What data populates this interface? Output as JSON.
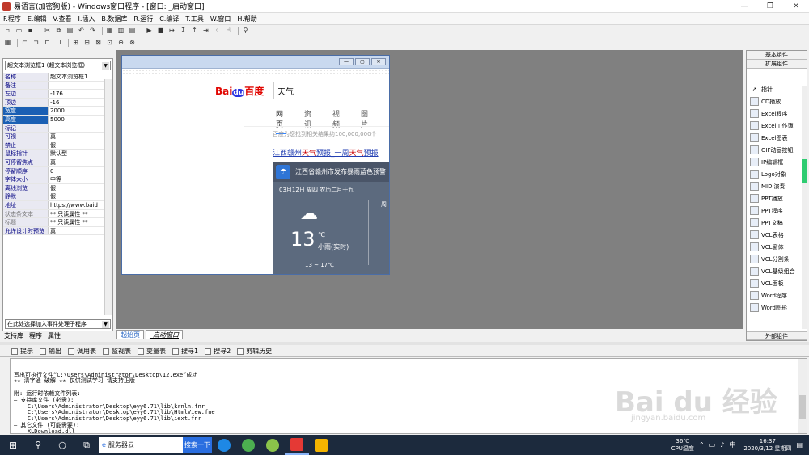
{
  "window": {
    "title": "易语言(加密狗版) - Windows窗口程序 - [窗口: _启动窗口]",
    "controls": [
      "—",
      "❐",
      "✕"
    ]
  },
  "menu": [
    "F.程序",
    "E.编辑",
    "V.查看",
    "I.插入",
    "B.数据库",
    "R.运行",
    "C.编译",
    "T.工具",
    "W.窗口",
    "H.帮助"
  ],
  "left_panel": {
    "object_select": "超文本浏览框1 (超文本浏览框)",
    "properties": [
      {
        "name": "名称",
        "value": "超文本浏览框1"
      },
      {
        "name": "备注",
        "value": ""
      },
      {
        "name": "左边",
        "value": "-176"
      },
      {
        "name": "顶边",
        "value": "-16"
      },
      {
        "name": "宽度",
        "value": "2000"
      },
      {
        "name": "高度",
        "value": "5000"
      },
      {
        "name": "标记",
        "value": ""
      },
      {
        "name": "可视",
        "value": "真"
      },
      {
        "name": "禁止",
        "value": "假"
      },
      {
        "name": "鼠标指针",
        "value": "默认型"
      },
      {
        "name": "可停留焦点",
        "value": "真"
      },
      {
        "name": "停留顺序",
        "value": "0"
      },
      {
        "name": "字体大小",
        "value": "中等"
      },
      {
        "name": "离线浏览",
        "value": "假"
      },
      {
        "name": "静默",
        "value": "假"
      },
      {
        "name": "地址",
        "value": "https://www.baid"
      },
      {
        "name": "状态条文本",
        "value": "** 只读属性 **"
      },
      {
        "name": "标题",
        "value": "** 只读属性 **"
      },
      {
        "name": "允许设计时预览",
        "value": "真"
      }
    ],
    "event_select": "在此处选择加入事件处理子程序",
    "tabs": [
      "支持库",
      "程序",
      "属性"
    ]
  },
  "browser": {
    "logo_a": "Bai",
    "logo_b": "du",
    "logo_c": "百度",
    "query": "天气",
    "tabs": [
      "网页",
      "资讯",
      "视频",
      "图片"
    ],
    "count": "百度为您找到相关结果约100,000,000个",
    "link_a": "江西赣州",
    "link_b": "天气",
    "link_c": "预报_一周",
    "link_d": "天气",
    "link_e": "预报",
    "weather_title": "江西省赣州市发布暴雨蓝色预警",
    "weather_date": "03月12日 周四 农历二月十九",
    "temp": "13",
    "unit": "℃",
    "desc": "小雨(实时)",
    "range": "13 ~ 17℃",
    "next_day": "周"
  },
  "right_panel": {
    "basic_label": "基本组件",
    "ext_label": "扩展组件",
    "external_label": "外部组件",
    "items": [
      {
        "label": "指针",
        "icon": "pointer-icon"
      },
      {
        "label": "CD播放",
        "icon": "cd-icon"
      },
      {
        "label": "Excel程序",
        "icon": "excel-icon"
      },
      {
        "label": "Excel工作簿",
        "icon": "excel-icon"
      },
      {
        "label": "Excel图表",
        "icon": "excel-icon"
      },
      {
        "label": "GIF动画按钮",
        "icon": "gif-icon"
      },
      {
        "label": "IP编辑框",
        "icon": "ip-icon"
      },
      {
        "label": "Logo对象",
        "icon": "logo-icon"
      },
      {
        "label": "MIDI演奏",
        "icon": "midi-icon"
      },
      {
        "label": "PPT播放",
        "icon": "ppt-icon"
      },
      {
        "label": "PPT程序",
        "icon": "ppt-icon"
      },
      {
        "label": "PPT文稿",
        "icon": "ppt-icon"
      },
      {
        "label": "VCL表格",
        "icon": "vcl-icon"
      },
      {
        "label": "VCL窗体",
        "icon": "vcl-icon"
      },
      {
        "label": "VCL分割条",
        "icon": "vcl-icon"
      },
      {
        "label": "VCL基级组合",
        "icon": "vcl-icon"
      },
      {
        "label": "VCL面板",
        "icon": "vcl-icon"
      },
      {
        "label": "Word程序",
        "icon": "word-icon"
      },
      {
        "label": "Word图形",
        "icon": "word-icon"
      }
    ]
  },
  "doc_tabs": [
    "起始页",
    "_启动窗口"
  ],
  "bottom_tabs": [
    "提示",
    "输出",
    "调用表",
    "监视表",
    "变量表",
    "搜寻1",
    "搜寻2",
    "剪辑历史"
  ],
  "output_lines": [
    "写出可执行文件“C:\\Users\\Administrator\\Desktop\\12.exe”成功",
    "★★ 清字通 破解 ★★ 仅供测试学习 请支持正版",
    "",
    "附: 运行时依赖文件列表:",
    "— 支持库文件 (必需):",
    "    C:\\Users\\Administrator\\Desktop\\eyy6.71\\lib\\krnln.fnr",
    "    C:\\Users\\Administrator\\Desktop\\eyy6.71\\lib\\HtmlView.fne",
    "    C:\\Users\\Administrator\\Desktop\\eyy6.71\\lib\\iext.fnr",
    "— 其它文件 (可能需要):",
    "    XLDownload.dll"
  ],
  "watermark": "Bai du 经验",
  "watermark_sub": "jingyan.baidu.com",
  "taskbar": {
    "search_text": "服务器云",
    "search_button": "搜索一下",
    "cpu_temp": "36℃",
    "cpu_label": "CPU温度",
    "ime": "中",
    "time": "16:37",
    "date": "2020/3/12 星期四"
  }
}
